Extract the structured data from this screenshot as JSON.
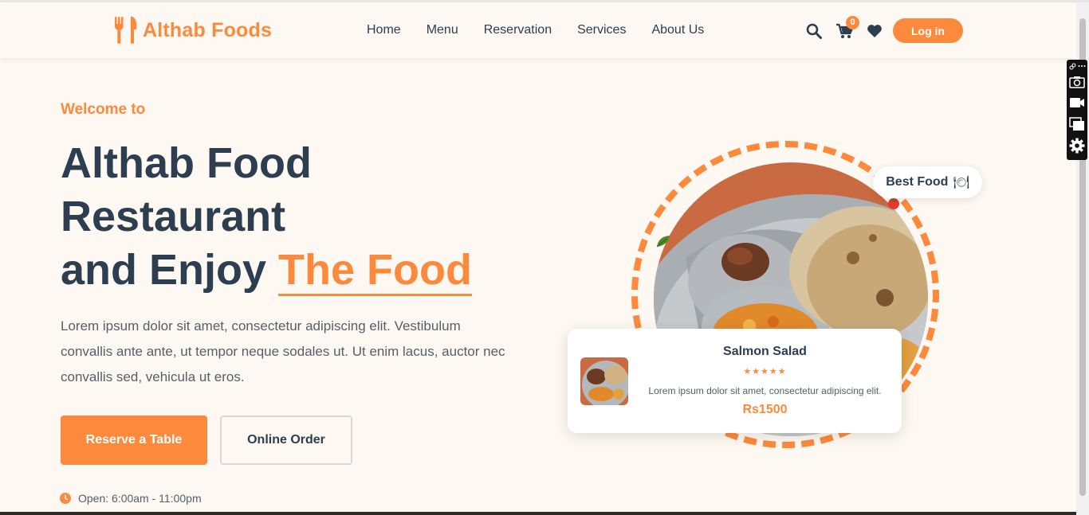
{
  "brand": {
    "name": "Althab Foods",
    "accent": "#fd8a3c",
    "text": "#2c3e50",
    "background": "#fdf8f1"
  },
  "nav": {
    "items": [
      "Home",
      "Menu",
      "Reservation",
      "Services",
      "About Us"
    ]
  },
  "header_actions": {
    "cart_count": "0",
    "login_label": "Log in",
    "icons": [
      "search-icon",
      "cart-icon",
      "heart-icon"
    ]
  },
  "hero": {
    "welcome": "Welcome to",
    "title_line1": "Althab Food",
    "title_line2": "Restaurant",
    "title_line3": "and Enjoy",
    "title_accent": "The Food",
    "description": "Lorem ipsum dolor sit amet, consectetur adipiscing elit. Vestibulum convallis ante ante, ut tempor neque sodales ut. Ut enim lacus, auctor nec convallis sed, vehicula ut eros.",
    "primary_button": "Reserve a Table",
    "secondary_button": "Online Order",
    "hours": "Open: 6:00am - 11:00pm"
  },
  "best_badge": {
    "label": "Best Food",
    "icon": "🍽"
  },
  "featured_card": {
    "title": "Salmon Salad",
    "stars": "★★★★★",
    "rating": 5,
    "description": "Lorem ipsum dolor sit amet, consectetur adipiscing elit.",
    "price": "Rs1500"
  }
}
